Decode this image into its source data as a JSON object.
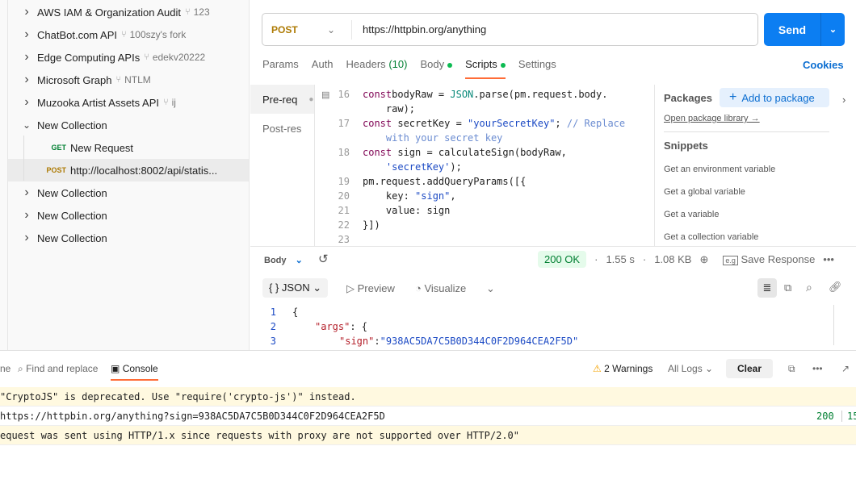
{
  "sidebar": {
    "items": [
      {
        "label": "AWS IAM & Organization Audit",
        "fork": "123",
        "expanded": false
      },
      {
        "label": "ChatBot.com API",
        "fork": "100szy's fork",
        "expanded": false
      },
      {
        "label": "Edge Computing APIs",
        "fork": "edekv20222",
        "expanded": false
      },
      {
        "label": "Microsoft Graph",
        "fork": "NTLM",
        "expanded": false
      },
      {
        "label": "Muzooka Artist Assets API",
        "fork": "ij",
        "expanded": false
      },
      {
        "label": "New Collection",
        "expanded": true
      },
      {
        "method": "GET",
        "label": "New Request"
      },
      {
        "method": "POST",
        "label": "http://localhost:8002/api/statis...",
        "selected": true
      },
      {
        "label": "New Collection",
        "expanded": false
      },
      {
        "label": "New Collection",
        "expanded": false
      },
      {
        "label": "New Collection",
        "expanded": false
      }
    ]
  },
  "request": {
    "method": "POST",
    "url": "https://httpbin.org/anything",
    "send": "Send"
  },
  "tabs": {
    "params": "Params",
    "auth": "Auth",
    "headers": "Headers",
    "headers_count": "(10)",
    "body": "Body",
    "scripts": "Scripts",
    "settings": "Settings",
    "cookies": "Cookies"
  },
  "scripts": {
    "pre": "Pre-req",
    "post": "Post-res"
  },
  "code": [
    {
      "n": "16",
      "tokens": [
        [
          "kw",
          "const"
        ],
        [
          "",
          "bodyRaw = "
        ],
        [
          "tp",
          "JSON"
        ],
        [
          "",
          ".parse(pm.request.body.\n    raw);"
        ]
      ]
    },
    {
      "n": "17",
      "tokens": [
        [
          "kw",
          "const"
        ],
        [
          "",
          " secretKey = "
        ],
        [
          "st",
          "\"yourSecretKey\""
        ],
        [
          "",
          "; "
        ],
        [
          "cm",
          "// Replace\n    with your secret key"
        ]
      ]
    },
    {
      "n": "18",
      "tokens": [
        [
          "kw",
          "const"
        ],
        [
          "",
          " sign = calculateSign(bodyRaw,\n    "
        ],
        [
          "st",
          "'secretKey'"
        ],
        [
          "",
          ");"
        ]
      ]
    },
    {
      "n": "19",
      "tokens": [
        [
          "",
          "pm.request.addQueryParams([{"
        ]
      ]
    },
    {
      "n": "20",
      "tokens": [
        [
          "",
          "    key: "
        ],
        [
          "st",
          "\"sign\""
        ],
        [
          "",
          ","
        ]
      ]
    },
    {
      "n": "21",
      "tokens": [
        [
          "",
          "    value: sign"
        ]
      ]
    },
    {
      "n": "22",
      "tokens": [
        [
          "",
          "}])"
        ]
      ]
    },
    {
      "n": "23",
      "tokens": [
        [
          "",
          ""
        ]
      ]
    }
  ],
  "packages": {
    "title": "Packages",
    "add": "Add to package",
    "open": "Open package library →",
    "snippets_title": "Snippets",
    "snippets": [
      "Get an environment variable",
      "Get a global variable",
      "Get a variable",
      "Get a collection variable"
    ]
  },
  "response": {
    "body": "Body",
    "status": "200 OK",
    "time": "1.55 s",
    "size": "1.08 KB",
    "save": "Save Response",
    "format": "JSON",
    "preview": "Preview",
    "visualize": "Visualize",
    "lines": [
      {
        "n": "1",
        "text": "{"
      },
      {
        "n": "2",
        "key": "\"args\"",
        "text": ": {"
      },
      {
        "n": "3",
        "key": "\"sign\"",
        "value": "\"938AC5DA7C5B0D344C0F2D964CEA2F5D\""
      }
    ]
  },
  "console": {
    "partial_tab": "ne",
    "find": "Find and replace",
    "console": "Console",
    "warnings": "2 Warnings",
    "logs": "All Logs",
    "clear": "Clear",
    "rows": [
      {
        "type": "warn",
        "text": " \"CryptoJS\" is deprecated. Use \"require('crypto-js')\" instead."
      },
      {
        "type": "log",
        "text": "https://httpbin.org/anything?sign=938AC5DA7C5B0D344C0F2D964CEA2F5D",
        "status": "200",
        "extra": "15"
      },
      {
        "type": "warn",
        "text": "equest was sent using HTTP/1.x since requests with proxy are not supported over HTTP/2.0\""
      }
    ]
  },
  "colors": {
    "accent": "#0c7ef2",
    "post": "#ad7a03",
    "get": "#007f31",
    "tab_underline": "#ff6c37"
  }
}
